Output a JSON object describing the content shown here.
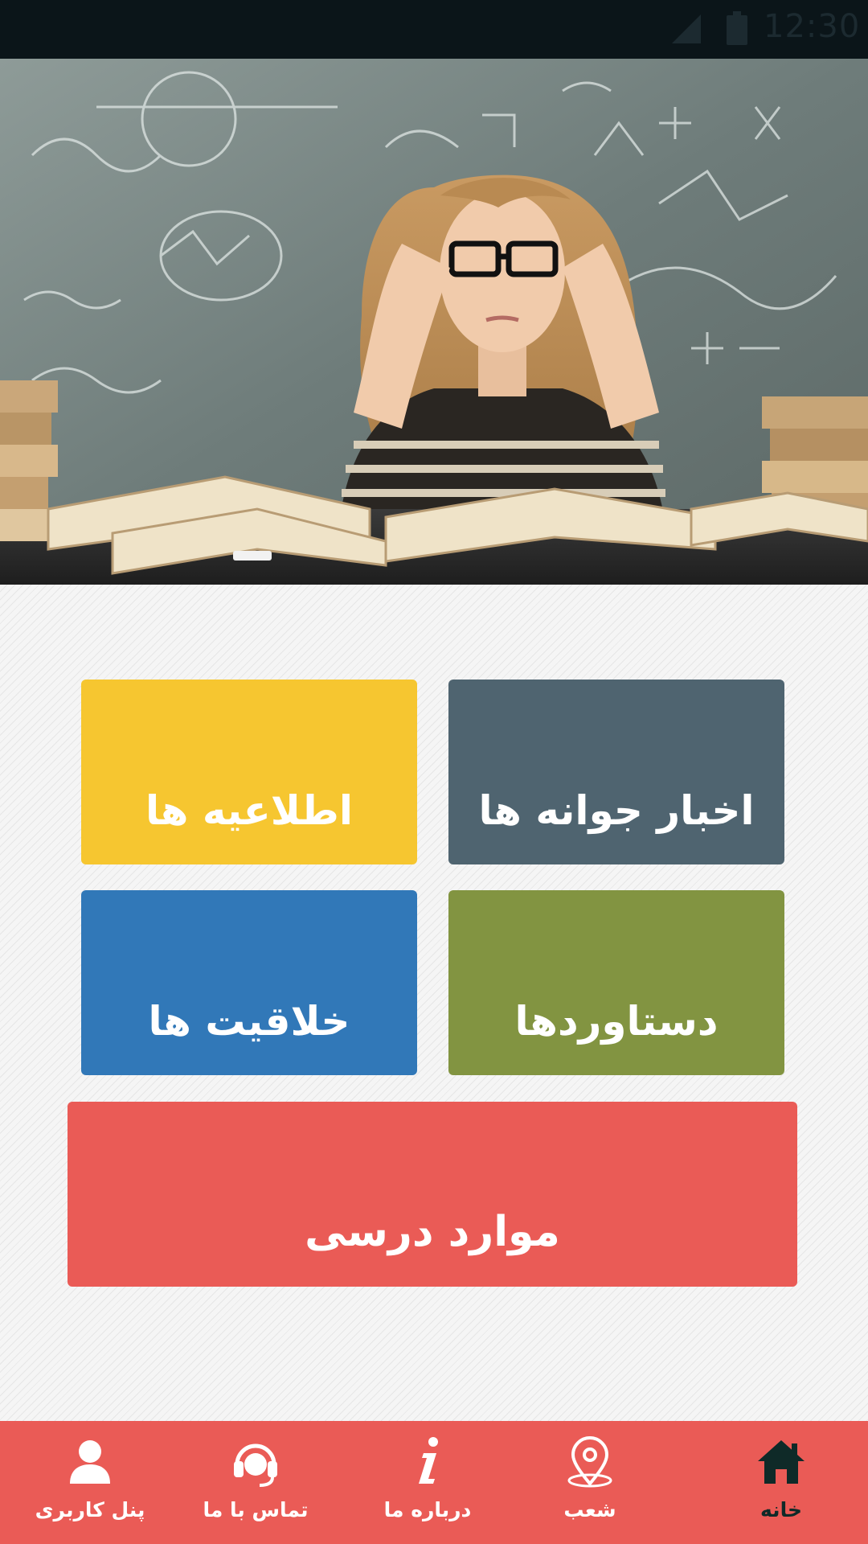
{
  "status_bar": {
    "time": "12:30",
    "signal_icon": "signal-icon",
    "battery_icon": "battery-icon"
  },
  "hero": {
    "image_icon": "hero-photo"
  },
  "tiles": {
    "news": {
      "label": "اخبار جوانه ها",
      "color": "#4f6470"
    },
    "notices": {
      "label": "اطلاعیه ها",
      "color": "#f6c630"
    },
    "achievements": {
      "label": "دستاوردها",
      "color": "#829441"
    },
    "creativity": {
      "label": "خلاقیت ها",
      "color": "#3178b8"
    },
    "lessons": {
      "label": "موارد درسی",
      "color": "#ea5b56"
    }
  },
  "bottom_nav": {
    "background": "#ea5b56",
    "items": [
      {
        "label": "خانه",
        "icon": "home-icon",
        "active": true
      },
      {
        "label": "شعب",
        "icon": "location-pin-icon",
        "active": false
      },
      {
        "label": "درباره ما",
        "icon": "info-icon",
        "active": false
      },
      {
        "label": "تماس با ما",
        "icon": "headset-icon",
        "active": false
      },
      {
        "label": "پنل کاربری",
        "icon": "user-icon",
        "active": false
      }
    ]
  }
}
